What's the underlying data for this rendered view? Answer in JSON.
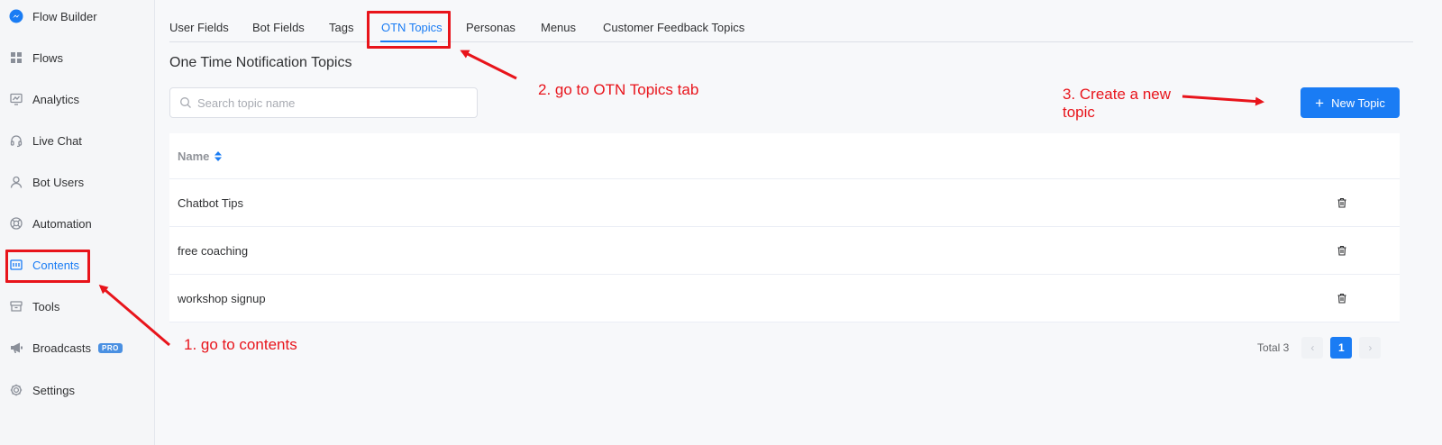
{
  "sidebar": {
    "items": [
      {
        "label": "Flow Builder",
        "icon": "messenger-icon"
      },
      {
        "label": "Flows",
        "icon": "grid-icon"
      },
      {
        "label": "Analytics",
        "icon": "chart-icon"
      },
      {
        "label": "Live Chat",
        "icon": "headset-icon"
      },
      {
        "label": "Bot Users",
        "icon": "user-icon"
      },
      {
        "label": "Automation",
        "icon": "lifebuoy-icon"
      },
      {
        "label": "Contents",
        "icon": "contents-icon"
      },
      {
        "label": "Tools",
        "icon": "toolbox-icon"
      },
      {
        "label": "Broadcasts",
        "icon": "megaphone-icon",
        "badge": "PRO"
      },
      {
        "label": "Settings",
        "icon": "gear-icon"
      }
    ],
    "active_item": "Contents"
  },
  "tabs": [
    {
      "label": "User Fields"
    },
    {
      "label": "Bot Fields"
    },
    {
      "label": "Tags"
    },
    {
      "label": "OTN Topics"
    },
    {
      "label": "Personas"
    },
    {
      "label": "Menus"
    },
    {
      "label": "Customer Feedback Topics"
    }
  ],
  "active_tab": "OTN Topics",
  "page": {
    "title": "One Time Notification Topics"
  },
  "search": {
    "placeholder": "Search topic name",
    "value": ""
  },
  "new_topic_button": {
    "label": "New Topic"
  },
  "table": {
    "columns": [
      {
        "label": "Name"
      }
    ],
    "rows": [
      {
        "name": "Chatbot Tips"
      },
      {
        "name": "free coaching"
      },
      {
        "name": "workshop signup"
      }
    ]
  },
  "pagination": {
    "total_label": "Total 3",
    "current_page": "1",
    "prev_icon": "‹",
    "next_icon": "›"
  },
  "annotations": {
    "step1": "1. go to contents",
    "step2": "2. go to OTN Topics tab",
    "step3_line1": "3. Create a new",
    "step3_line2": "topic",
    "color": "#e8141b"
  },
  "colors": {
    "accent": "#1a7cf4",
    "sidebar_bg": "#f5f6f8",
    "page_bg": "#f7f8fa"
  }
}
